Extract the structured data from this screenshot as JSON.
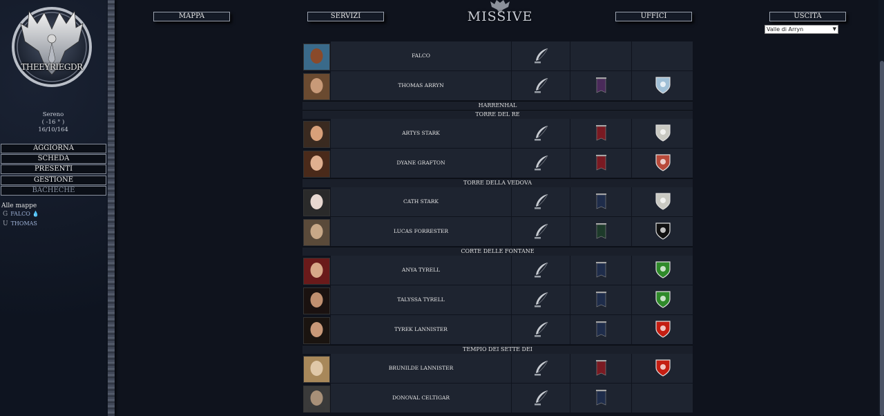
{
  "sidebar": {
    "logo_text": "THEEYRIEGDR",
    "weather": "Sereno",
    "temperature": "( -16 ° )",
    "date": "16/10/164",
    "buttons": [
      "AGGIORNA",
      "SCHEDA",
      "PRESENTI",
      "GESTIONE",
      "BACHECHE"
    ],
    "maps_title": "Alle mappe",
    "map_users": [
      {
        "glyph": "G",
        "name": "FALCO",
        "icon": "drop-icon"
      },
      {
        "glyph": "U",
        "name": "THOMAS"
      }
    ]
  },
  "nav": {
    "mappa": "MAPPA",
    "servizi": "SERVIZI",
    "title": "MISSIVE",
    "uffici": "UFFICI",
    "uscita": "USCITA",
    "select_value": "Valle di Arryn"
  },
  "colors": {
    "banner_purple": "#4a2a5a",
    "banner_red": "#7a1a22",
    "banner_blue": "#1e2c4a",
    "banner_green": "#1d3a2a",
    "shield_arryn": "#9fbfd6",
    "shield_stark": "#c9c9c2",
    "shield_grafton": "#b84a3a",
    "shield_forrester": "#ffffff",
    "shield_tyrell": "#2f8a2a",
    "shield_lannister": "#c41e12"
  },
  "rows": [
    {
      "name": "FALCO",
      "avatar": "falcon",
      "banner": null,
      "shield": null
    },
    {
      "name": "THOMAS ARRYN",
      "avatar": "man-beard",
      "banner": "purple",
      "shield": "arryn"
    },
    {
      "section": "HARRENHAL"
    },
    {
      "section": "TORRE DEL RE"
    },
    {
      "name": "ARTYS STARK",
      "avatar": "man-curly",
      "banner": "red",
      "shield": "stark"
    },
    {
      "name": "DYANE GRAFTON",
      "avatar": "woman-brown",
      "banner": "red",
      "shield": "grafton"
    },
    {
      "section": "TORRE DELLA VEDOVA"
    },
    {
      "name": "CATH STARK",
      "avatar": "woman-pale",
      "banner": "blue",
      "shield": "stark"
    },
    {
      "name": "LUCAS FORRESTER",
      "avatar": "man-long-hair",
      "banner": "green",
      "shield": "forrester"
    },
    {
      "section": "CORTE DELLE FONTANE"
    },
    {
      "name": "ANYA TYRELL",
      "avatar": "woman-red",
      "banner": "blue",
      "shield": "tyrell"
    },
    {
      "name": "TALYSSA TYRELL",
      "avatar": "woman-dark",
      "banner": "blue",
      "shield": "tyrell"
    },
    {
      "name": "TYREK LANNISTER",
      "avatar": "man-dark-hair",
      "banner": "blue",
      "shield": "lannister"
    },
    {
      "section": "TEMPIO DEI SETTE DEI"
    },
    {
      "name": "BRUNILDE LANNISTER",
      "avatar": "woman-blonde",
      "banner": "red",
      "shield": "lannister"
    },
    {
      "name": "DONOVAL CELTIGAR",
      "avatar": "man-grey",
      "banner": "blue",
      "shield": null
    }
  ]
}
